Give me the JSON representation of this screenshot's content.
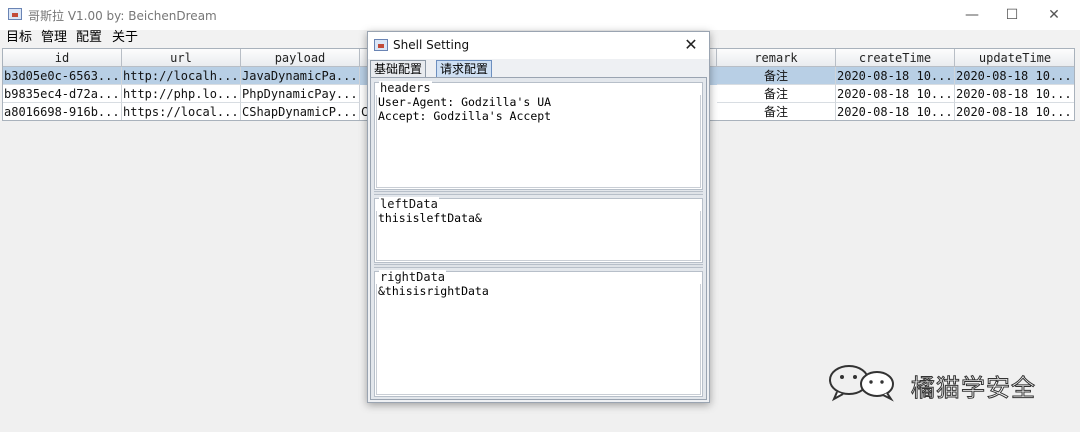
{
  "window": {
    "title": "哥斯拉 V1.00    by: BeichenDream",
    "controls": [
      "—",
      "☐",
      "✕"
    ]
  },
  "menu": [
    "目标",
    "管理",
    "配置",
    "关于"
  ],
  "table": {
    "columns": [
      "id",
      "url",
      "payload",
      "",
      "",
      "",
      "remark",
      "createTime",
      "updateTime"
    ],
    "rows": [
      {
        "id": "b3d05e0c-6563...",
        "url": "http://localh...",
        "payload": "JavaDynamicPa...",
        "remark": "备注",
        "createTime": "2020-08-18 10...",
        "updateTime": "2020-08-18 10...",
        "selected": true
      },
      {
        "id": "b9835ec4-d72a...",
        "url": "http://php.lo...",
        "payload": "PhpDynamicPay...",
        "remark": "备注",
        "createTime": "2020-08-18 10...",
        "updateTime": "2020-08-18 10...",
        "selected": false
      },
      {
        "id": "a8016698-916b...",
        "url": "https://local...",
        "payload": "CShapDynamicP...",
        "extra": "C",
        "remark": "备注",
        "createTime": "2020-08-18 10...",
        "updateTime": "2020-08-18 10...",
        "selected": false
      }
    ]
  },
  "dialog": {
    "title": "Shell Setting",
    "close": "✕",
    "tabs": [
      {
        "label": "基础配置",
        "active": false
      },
      {
        "label": "请求配置",
        "active": true
      }
    ],
    "headers": {
      "label": "headers",
      "lines": [
        "User-Agent: Godzilla's UA",
        "Accept: Godzilla's Accept"
      ]
    },
    "leftData": {
      "label": "leftData",
      "lines": [
        "thisisleftData&"
      ]
    },
    "rightData": {
      "label": "rightData",
      "lines": [
        "&thisisrightData"
      ]
    }
  },
  "watermark": {
    "text": "橘猫学安全",
    "icon": "wechat-icon"
  },
  "colors": {
    "selection": "#b8cfe5",
    "active_tab": "#cfe0f4",
    "background": "#f0f0f0"
  }
}
